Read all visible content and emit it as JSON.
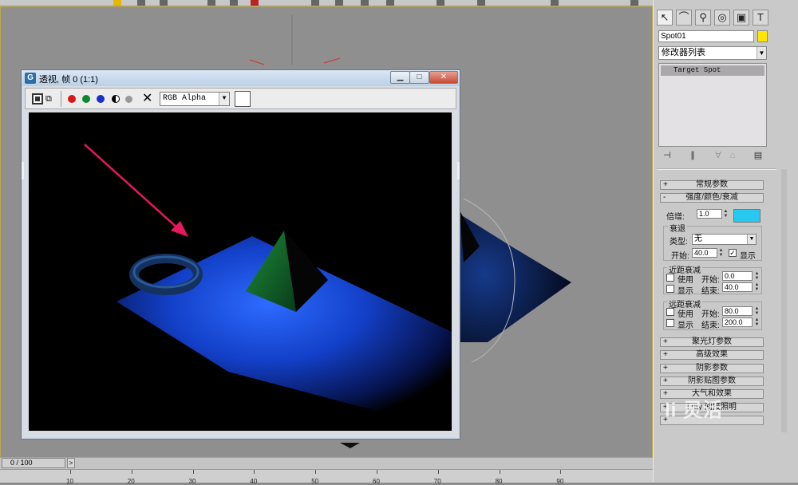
{
  "render_window": {
    "title": "透视, 帧 0 (1:1)",
    "app_icon": "G",
    "min_glyph": "▁",
    "max_glyph": "□",
    "close_glyph": "✕",
    "channel_select": "RGB Alpha"
  },
  "command_panel": {
    "tab_icons": [
      "create-icon",
      "modify-icon",
      "hierarchy-icon",
      "motion-icon",
      "display-icon",
      "utilities-icon"
    ],
    "object_name": "Spot01",
    "object_color": "#ffe600",
    "modifier_list": "修改器列表",
    "modifier_stack_item": "Target Spot"
  },
  "rollouts": {
    "general": {
      "sign": "+",
      "label": "常规参数"
    },
    "intensity": {
      "sign": "-",
      "label": "强度/颜色/衰减",
      "multiplier_label": "倍增:",
      "multiplier_value": "1.0",
      "color": "#27c9f0",
      "decay_group": "衰退",
      "type_label": "类型:",
      "type_value": "无",
      "start_label": "开始:",
      "start_value": "40.0",
      "show_label": "显示",
      "near_group": "近距衰减",
      "near_use": "使用",
      "near_start_label": "开始:",
      "near_start_value": "0.0",
      "near_show": "显示",
      "near_end_label": "结束:",
      "near_end_value": "40.0",
      "far_group": "远距衰减",
      "far_use": "使用",
      "far_start_label": "开始:",
      "far_start_value": "80.0",
      "far_show": "显示",
      "far_end_label": "结束:",
      "far_end_value": "200.0"
    },
    "spotlight": {
      "sign": "+",
      "label": "聚光灯参数"
    },
    "advanced": {
      "sign": "+",
      "label": "高级效果"
    },
    "shadow": {
      "sign": "+",
      "label": "阴影参数"
    },
    "shadow_map": {
      "sign": "+",
      "label": "阴影贴图参数"
    },
    "atmos": {
      "sign": "+",
      "label": "大气和效果"
    },
    "mental": {
      "sign": "+",
      "label": "l ray 间接照明"
    },
    "last": {
      "sign": "+",
      "label": ""
    }
  },
  "timeline": {
    "slider_text": "0 / 100",
    "next_glyph": ">",
    "ticks": [
      "10",
      "20",
      "30",
      "40",
      "50",
      "60",
      "70",
      "80",
      "90"
    ]
  },
  "watermark": "li 灵活"
}
